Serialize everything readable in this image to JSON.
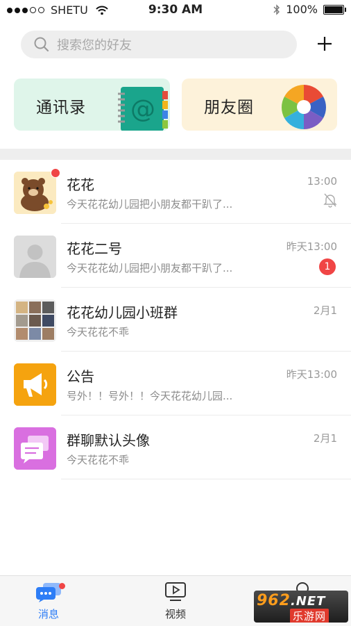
{
  "status_bar": {
    "carrier": "SHETU",
    "time": "9:30 AM",
    "battery": "100%"
  },
  "search": {
    "placeholder": "搜索您的好友"
  },
  "shortcuts": {
    "contacts_label": "通讯录",
    "moments_label": "朋友圈"
  },
  "conversations": [
    {
      "name": "花花",
      "message": "今天花花幼儿园把小朋友都干趴了...",
      "time": "13:00",
      "muted": true,
      "unread_dot": true
    },
    {
      "name": "花花二号",
      "message": "今天花花幼儿园把小朋友都干趴了...",
      "time": "昨天13:00",
      "badge": "1"
    },
    {
      "name": "花花幼儿园小班群",
      "message": "今天花花不乖",
      "time": "2月1"
    },
    {
      "name": "公告",
      "message": "号外！！号外！！今天花花幼儿园...",
      "time": "昨天13:00"
    },
    {
      "name": "群聊默认头像",
      "message": "今天花花不乖",
      "time": "2月1"
    }
  ],
  "tabs": {
    "messages": "消息",
    "video": "视频"
  },
  "watermark": {
    "brand": "962",
    "net": ".NET",
    "sub": "乐游网"
  },
  "colors": {
    "accent": "#2d7df6",
    "badge_red": "#f04545",
    "contacts_bg": "#dff5ea",
    "moments_bg": "#fdf2da",
    "announcement_orange": "#f5a30f",
    "group_default_purple": "#d96fe0"
  }
}
